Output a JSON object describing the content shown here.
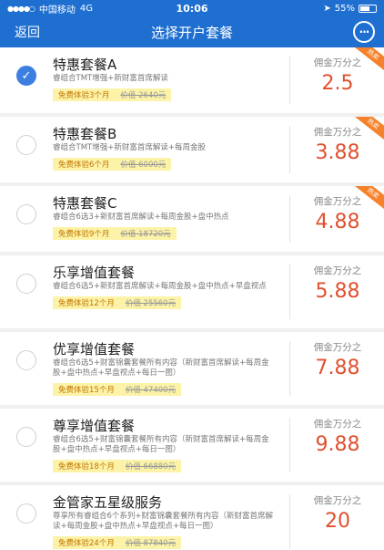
{
  "status": {
    "carrier": "中国移动",
    "network": "4G",
    "time": "10:06",
    "battery": "55%"
  },
  "nav": {
    "back": "返回",
    "title": "选择开户套餐",
    "chat_icon": "···"
  },
  "packages": [
    {
      "name": "特惠套餐A",
      "desc": "睿组合TMT增强+新财富首席解读",
      "trial": "免费体验3个月",
      "price": "价值 2640元",
      "comm_label": "佣金万分之",
      "rate": "2.5",
      "hot": "热卖",
      "checked": true
    },
    {
      "name": "特惠套餐B",
      "desc": "睿组合TMT增强+新财富首席解读+每周金股",
      "trial": "免费体验6个月",
      "price": "价值 6000元",
      "comm_label": "佣金万分之",
      "rate": "3.88",
      "hot": "热卖",
      "checked": false
    },
    {
      "name": "特惠套餐C",
      "desc": "睿组合6选3+新财富首席解读+每周金股+盘中热点",
      "trial": "免费体验9个月",
      "price": "价值 18720元",
      "comm_label": "佣金万分之",
      "rate": "4.88",
      "hot": "热卖",
      "checked": false
    },
    {
      "name": "乐享增值套餐",
      "desc": "睿组合6选5+新财富首席解读+每周金股+盘中热点+早盘视点",
      "trial": "免费体验12个月",
      "price": "价值 25560元",
      "comm_label": "佣金万分之",
      "rate": "5.88",
      "hot": "",
      "checked": false
    },
    {
      "name": "优享增值套餐",
      "desc": "睿组合6选5+财富锦囊套餐所有内容（新财富首席解读+每周金股+盘中热点+早盘视点+每日一图）",
      "trial": "免费体验15个月",
      "price": "价值 47400元",
      "comm_label": "佣金万分之",
      "rate": "7.88",
      "hot": "",
      "checked": false
    },
    {
      "name": "尊享增值套餐",
      "desc": "睿组合6选5+财富锦囊套餐所有内容（新财富首席解读+每周金股+盘中热点+早盘视点+每日一图）",
      "trial": "免费体验18个月",
      "price": "价值 66880元",
      "comm_label": "佣金万分之",
      "rate": "9.88",
      "hot": "",
      "checked": false
    },
    {
      "name": "金管家五星级服务",
      "desc": "尊享所有睿组合6个系列+财富锦囊套餐所有内容（新财富首席解读+每周金股+盘中热点+早盘视点+每日一图）",
      "trial": "免费体验24个月",
      "price": "价值 87840元",
      "comm_label": "佣金万分之",
      "rate": "20",
      "hot": "",
      "checked": false
    }
  ]
}
